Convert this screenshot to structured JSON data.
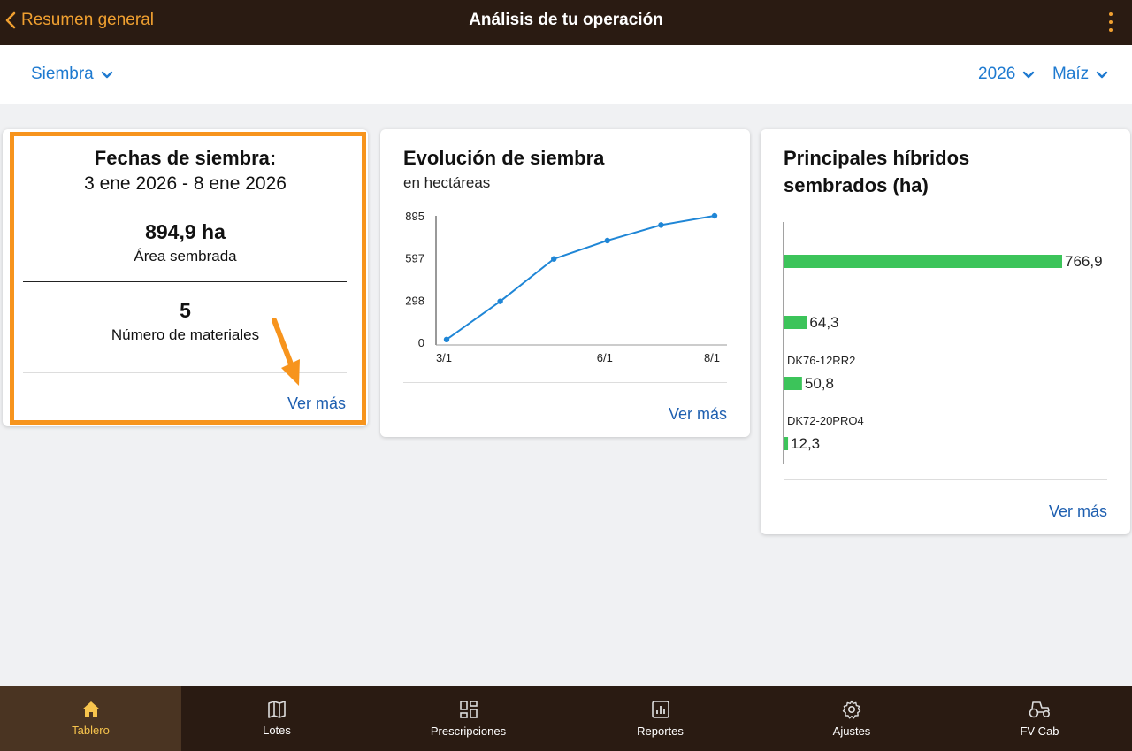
{
  "header": {
    "back_label": "Resumen general",
    "title": "Análisis de tu operación"
  },
  "filters": {
    "activity": "Siembra",
    "year": "2026",
    "crop": "Maíz"
  },
  "sowing_card": {
    "title": "Fechas de siembra:",
    "date_range": "3 ene 2026 - 8 ene 2026",
    "area_value": "894,9 ha",
    "area_label": "Área sembrada",
    "materials_value": "5",
    "materials_label": "Número de materiales",
    "more_label": "Ver más"
  },
  "evolution_card": {
    "title": "Evolución de siembra",
    "subtitle": "en hectáreas",
    "more_label": "Ver más"
  },
  "hybrids_card": {
    "title_line1": "Principales híbridos",
    "title_line2": "sembrados (ha)",
    "more_label": "Ver más"
  },
  "chart_data": [
    {
      "type": "line",
      "title": "Evolución de siembra",
      "subtitle": "en hectáreas",
      "x": [
        "3/1",
        "4/1",
        "5/1",
        "6/1",
        "7/1",
        "8/1"
      ],
      "x_tick_labels": [
        "3/1",
        "6/1",
        "8/1"
      ],
      "values": [
        20,
        290,
        590,
        720,
        830,
        895
      ],
      "y_tick_labels": [
        "0",
        "298",
        "597",
        "895"
      ],
      "ylim": [
        0,
        895
      ],
      "color": "#1f86d6",
      "grid": false
    },
    {
      "type": "bar",
      "orientation": "horizontal",
      "title": "Principales híbridos sembrados (ha)",
      "categories": [
        "",
        "",
        "DK76-12RR2",
        "DK72-20PRO4"
      ],
      "values": [
        766.9,
        64.3,
        50.8,
        12.3
      ],
      "value_labels": [
        "766,9",
        "64,3",
        "50,8",
        "12,3"
      ],
      "xlim": [
        0,
        766.9
      ],
      "color": "#3cc45a"
    }
  ],
  "nav": {
    "items": [
      {
        "label": "Tablero",
        "icon": "home-icon",
        "active": true
      },
      {
        "label": "Lotes",
        "icon": "map-icon",
        "active": false
      },
      {
        "label": "Prescripciones",
        "icon": "grid-icon",
        "active": false
      },
      {
        "label": "Reportes",
        "icon": "report-icon",
        "active": false
      },
      {
        "label": "Ajustes",
        "icon": "gear-icon",
        "active": false
      },
      {
        "label": "FV Cab",
        "icon": "tractor-icon",
        "active": false
      }
    ]
  },
  "colors": {
    "header_bg": "#2a1b12",
    "accent_orange": "#f0a030",
    "link_blue": "#1e7ad0",
    "highlight": "#f7941d",
    "bar_green": "#3cc45a",
    "line_blue": "#1f86d6"
  }
}
